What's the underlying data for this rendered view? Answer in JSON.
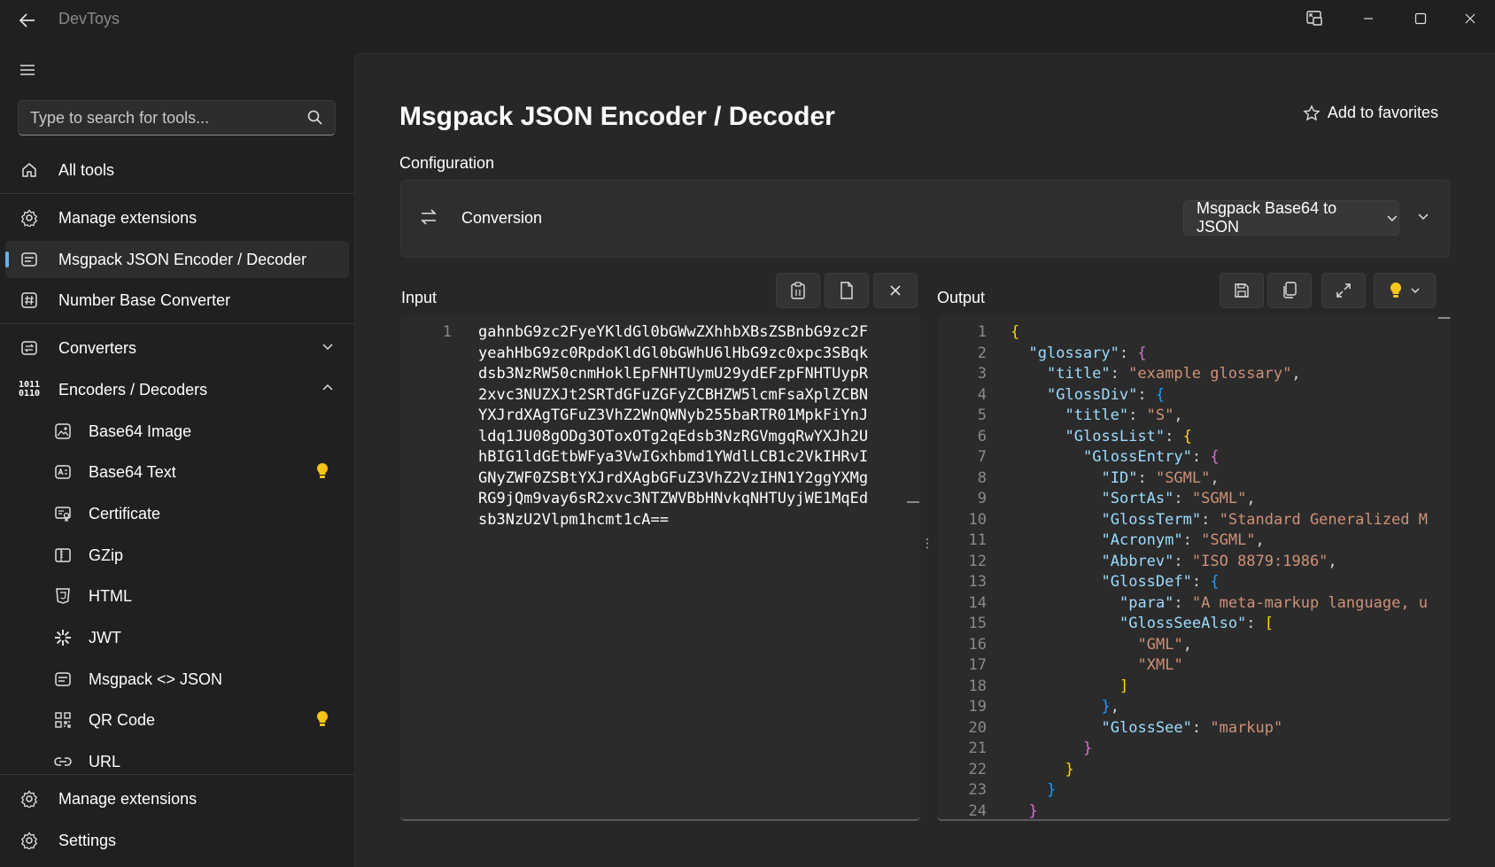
{
  "app": {
    "title": "DevToys"
  },
  "sidebar": {
    "search": {
      "placeholder": "Type to search for tools..."
    },
    "items": [
      {
        "label": "All tools",
        "icon": "home-icon"
      },
      {
        "label": "Manage extensions",
        "icon": "gear-icon"
      },
      {
        "label": "Msgpack JSON Encoder / Decoder",
        "icon": "msgpack-icon",
        "selected": true
      },
      {
        "label": "Number Base Converter",
        "icon": "hash-icon"
      },
      {
        "label": "Converters",
        "icon": "converters-icon",
        "expanded": false
      },
      {
        "label": "Encoders / Decoders",
        "icon": "binary-icon",
        "expanded": true
      },
      {
        "label": "Base64 Image",
        "icon": "image-icon"
      },
      {
        "label": "Base64 Text",
        "icon": "text-icon",
        "badge": "lightbulb-icon"
      },
      {
        "label": "Certificate",
        "icon": "certificate-icon"
      },
      {
        "label": "GZip",
        "icon": "gzip-icon"
      },
      {
        "label": "HTML",
        "icon": "html-icon"
      },
      {
        "label": "JWT",
        "icon": "jwt-icon"
      },
      {
        "label": "Msgpack <> JSON",
        "icon": "msgpack-icon"
      },
      {
        "label": "QR Code",
        "icon": "qr-icon",
        "badge": "lightbulb-icon"
      },
      {
        "label": "URL",
        "icon": "link-icon"
      }
    ],
    "footer": [
      {
        "label": "Manage extensions",
        "icon": "gear-icon"
      },
      {
        "label": "Settings",
        "icon": "settings-icon"
      }
    ]
  },
  "main": {
    "title": "Msgpack JSON Encoder / Decoder",
    "favorite_label": "Add to favorites",
    "configuration_label": "Configuration",
    "conversion": {
      "label": "Conversion",
      "selected_option": "Msgpack Base64 to JSON"
    },
    "input": {
      "label": "Input",
      "line_number": "1",
      "lines": [
        "gahnbG9zc2FyeYKldGl0bGWwZXhhbXBsZSBnbG9zc2F",
        "yeahHbG9zc0RpdoKldGl0bGWhU6lHbG9zc0xpc3SBqk",
        "dsb3NzRW50cnmHoklEpFNHTUymU29ydEFzpFNHTUypR",
        "2xvc3NUZXJt2SRTdGFuZGFyZCBHZW5lcmFsaXplZCBN",
        "YXJrdXAgTGFuZ3VhZ2WnQWNyb255baRTR01MpkFiYnJ",
        "ldq1JU08gODg3OToxOTg2qEdsb3NzRGVmgqRwYXJh2U",
        "hBIG1ldGEtbWFya3VwIGxhbmd1YWdlLCB1c2VkIHRvI",
        "GNyZWF0ZSBtYXJrdXAgbGFuZ3VhZ2VzIHN1Y2ggYXMg",
        "RG9jQm9vay6sR2xvc3NTZWVBbHNvkqNHTUyjWE1MqEd",
        "sb3NzU2Vlpm1hcmt1cA=="
      ]
    },
    "output": {
      "label": "Output",
      "line_numbers": [
        "1",
        "2",
        "3",
        "4",
        "5",
        "6",
        "7",
        "8",
        "9",
        "10",
        "11",
        "12",
        "13",
        "14",
        "15",
        "16",
        "17",
        "18",
        "19",
        "20",
        "21",
        "22",
        "23",
        "24"
      ],
      "code": [
        "{",
        "  \"glossary\": {",
        "    \"title\": \"example glossary\",",
        "    \"GlossDiv\": {",
        "      \"title\": \"S\",",
        "      \"GlossList\": {",
        "        \"GlossEntry\": {",
        "          \"ID\": \"SGML\",",
        "          \"SortAs\": \"SGML\",",
        "          \"GlossTerm\": \"Standard Generalized M",
        "          \"Acronym\": \"SGML\",",
        "          \"Abbrev\": \"ISO 8879:1986\",",
        "          \"GlossDef\": {",
        "            \"para\": \"A meta-markup language, u",
        "            \"GlossSeeAlso\": [",
        "              \"GML\",",
        "              \"XML\"",
        "            ]",
        "          },",
        "          \"GlossSee\": \"markup\"",
        "        }",
        "      }",
        "    }",
        "  }"
      ]
    }
  },
  "colors": {
    "accent": "#5fb2f2",
    "bulb": "#f5c518",
    "json_key": "#9cdcfe",
    "json_string": "#ce9178",
    "brace_gold": "#ffd700",
    "brace_purple": "#da70d6",
    "brace_blue": "#179fff"
  }
}
